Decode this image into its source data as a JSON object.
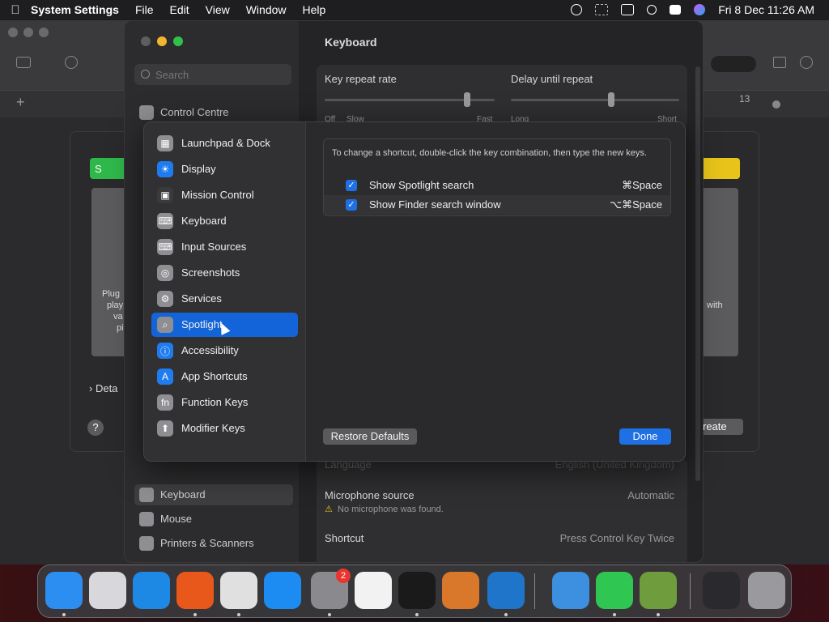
{
  "menubar": {
    "app_name": "System Settings",
    "menus": [
      "File",
      "Edit",
      "View",
      "Window",
      "Help"
    ],
    "clock": "Fri 8 Dec  11:26 AM"
  },
  "background_window": {
    "green_button": "S",
    "text_left": [
      "Plug",
      "play",
      "va",
      "pi"
    ],
    "text_right": "with",
    "details": "Deta",
    "help": "?",
    "create": "reate",
    "ruler_number": "13"
  },
  "settings": {
    "search_placeholder": "Search",
    "title": "Keyboard",
    "sidebar_top": "Control Centre",
    "sidebar_bottom": [
      "Keyboard",
      "Mouse",
      "Printers & Scanners"
    ],
    "key_repeat_rate": "Key repeat rate",
    "delay_until_repeat": "Delay until repeat",
    "rate_ticks": [
      "Off",
      "Slow",
      "Fast"
    ],
    "delay_ticks": [
      "Long",
      "Short"
    ],
    "language_label": "Language",
    "language_value": "English (United Kingdom)",
    "mic_label": "Microphone source",
    "mic_value": "Automatic",
    "mic_warning": "No microphone was found.",
    "shortcut_label": "Shortcut",
    "shortcut_value": "Press Control Key Twice"
  },
  "sheet": {
    "categories": [
      {
        "label": "Launchpad & Dock",
        "color": "#8e8e93",
        "glyph": "▦"
      },
      {
        "label": "Display",
        "color": "#1f7cf0",
        "glyph": "☀"
      },
      {
        "label": "Mission Control",
        "color": "#3a3a3c",
        "glyph": "▣"
      },
      {
        "label": "Keyboard",
        "color": "#8e8e93",
        "glyph": "⌨"
      },
      {
        "label": "Input Sources",
        "color": "#8e8e93",
        "glyph": "⌨"
      },
      {
        "label": "Screenshots",
        "color": "#8e8e93",
        "glyph": "◎"
      },
      {
        "label": "Services",
        "color": "#8e8e93",
        "glyph": "⚙"
      },
      {
        "label": "Spotlight",
        "color": "#8e8e93",
        "glyph": "⌕"
      },
      {
        "label": "Accessibility",
        "color": "#1f7cf0",
        "glyph": "ⓘ"
      },
      {
        "label": "App Shortcuts",
        "color": "#1f7cf0",
        "glyph": "A"
      },
      {
        "label": "Function Keys",
        "color": "#8e8e93",
        "glyph": "fn"
      },
      {
        "label": "Modifier Keys",
        "color": "#8e8e93",
        "glyph": "⬆"
      }
    ],
    "selected_index": 7,
    "info_text": "To change a shortcut, double-click the key combination, then type the new keys.",
    "shortcuts": [
      {
        "label": "Show Spotlight search",
        "keys": "⌘Space",
        "checked": "✓"
      },
      {
        "label": "Show Finder search window",
        "keys": "⌥⌘Space",
        "checked": "✓"
      }
    ],
    "restore_label": "Restore Defaults",
    "done_label": "Done"
  },
  "dock": {
    "apps": [
      {
        "name": "finder",
        "color": "#2c8ef0"
      },
      {
        "name": "launchpad",
        "color": "#d8d8dc"
      },
      {
        "name": "safari",
        "color": "#1e88e5"
      },
      {
        "name": "firefox",
        "color": "#e8581a"
      },
      {
        "name": "chrome",
        "color": "#e0e0e0"
      },
      {
        "name": "app-store",
        "color": "#1d8cf2"
      },
      {
        "name": "system-settings",
        "color": "#8a8a8e"
      },
      {
        "name": "textedit",
        "color": "#f2f2f2"
      },
      {
        "name": "terminal",
        "color": "#1a1a1a"
      },
      {
        "name": "garageband",
        "color": "#d9782a"
      },
      {
        "name": "vscode",
        "color": "#1f75c9"
      },
      {
        "name": "weather",
        "color": "#3d8fe0"
      },
      {
        "name": "facetime",
        "color": "#2fc652"
      },
      {
        "name": "minecraft",
        "color": "#6f9c3c"
      },
      {
        "name": "screen-window",
        "color": "#2a2a2e"
      },
      {
        "name": "trash",
        "color": "#9a9a9e"
      }
    ],
    "badge": "2"
  }
}
